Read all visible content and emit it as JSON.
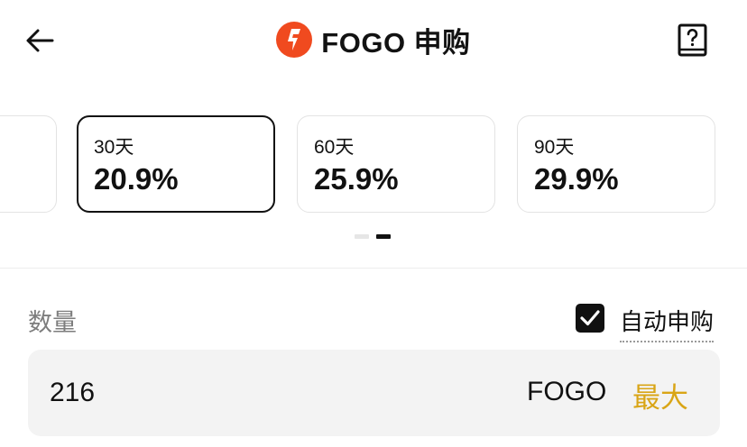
{
  "header": {
    "title": "FOGO 申购",
    "back_icon": "arrow-left-icon",
    "logo_icon": "fogo-logo-icon",
    "help_icon": "book-question-icon",
    "logo_color": "#f04a1f"
  },
  "terms": [
    {
      "label": "",
      "rate": "",
      "selected": false
    },
    {
      "label": "30天",
      "rate": "20.9%",
      "selected": true
    },
    {
      "label": "60天",
      "rate": "25.9%",
      "selected": false
    },
    {
      "label": "90天",
      "rate": "29.9%",
      "selected": false
    }
  ],
  "pagination": {
    "pages": 2,
    "active": 2
  },
  "quantity": {
    "label": "数量",
    "value": "216",
    "unit": "FOGO",
    "max_label": "最大"
  },
  "auto_subscribe": {
    "label": "自动申购",
    "checked": true
  },
  "colors": {
    "accent": "#d9a516",
    "text": "#111111",
    "muted": "#7d7d7d",
    "input_bg": "#f3f3f3"
  }
}
